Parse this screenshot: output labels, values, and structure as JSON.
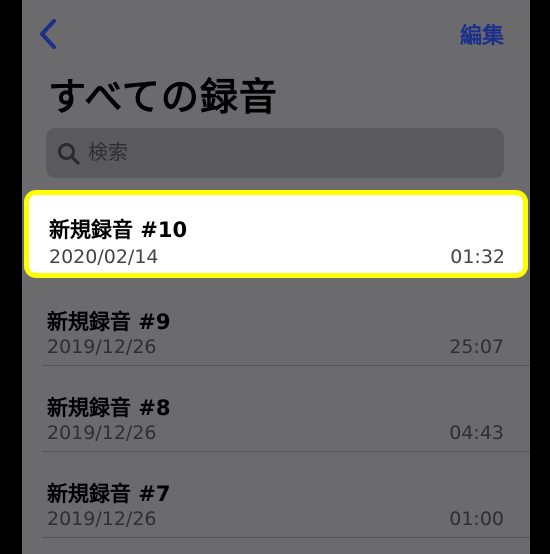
{
  "nav": {
    "edit_label": "編集"
  },
  "page": {
    "title": "すべての録音"
  },
  "search": {
    "placeholder": "検索"
  },
  "recordings": [
    {
      "name": "新規録音 #10",
      "date": "2020/02/14",
      "duration": "01:32",
      "highlighted": true
    },
    {
      "name": "新規録音 #9",
      "date": "2019/12/26",
      "duration": "25:07"
    },
    {
      "name": "新規録音 #8",
      "date": "2019/12/26",
      "duration": "04:43"
    },
    {
      "name": "新規録音 #7",
      "date": "2019/12/26",
      "duration": "01:00"
    }
  ],
  "colors": {
    "accent": "#1c2f8a",
    "highlight_border": "#ffff00",
    "dimmed_background": "#6b6b6e"
  },
  "icons": {
    "back": "chevron-left-icon",
    "search": "magnifier-icon"
  }
}
